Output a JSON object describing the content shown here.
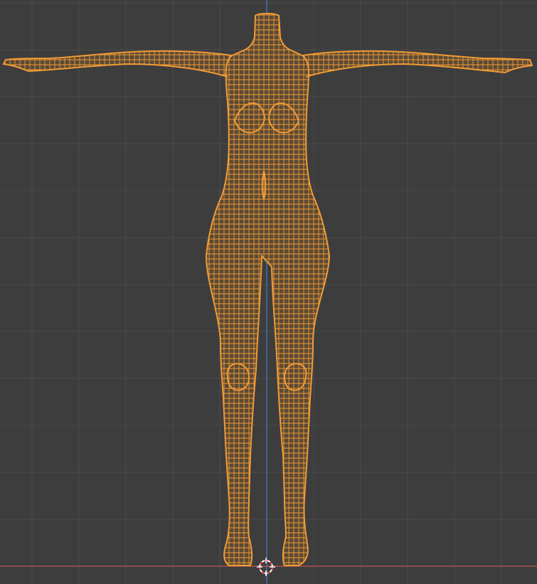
{
  "viewport": {
    "background": "#3d3d3d",
    "grid_color": "#4b4b4b",
    "x_axis_color": "#c0564e",
    "z_axis_color": "#4a78c2",
    "wire_color": "#f29b35",
    "mesh_fill": "#5a4a36",
    "cursor_color": "#ffffff",
    "cursor_accent": "#d83a3a"
  },
  "scene": {
    "object": "female-base-mesh",
    "display_mode": "wireframe",
    "selected": true
  },
  "cursor": {
    "icon": "3d-cursor-icon"
  }
}
